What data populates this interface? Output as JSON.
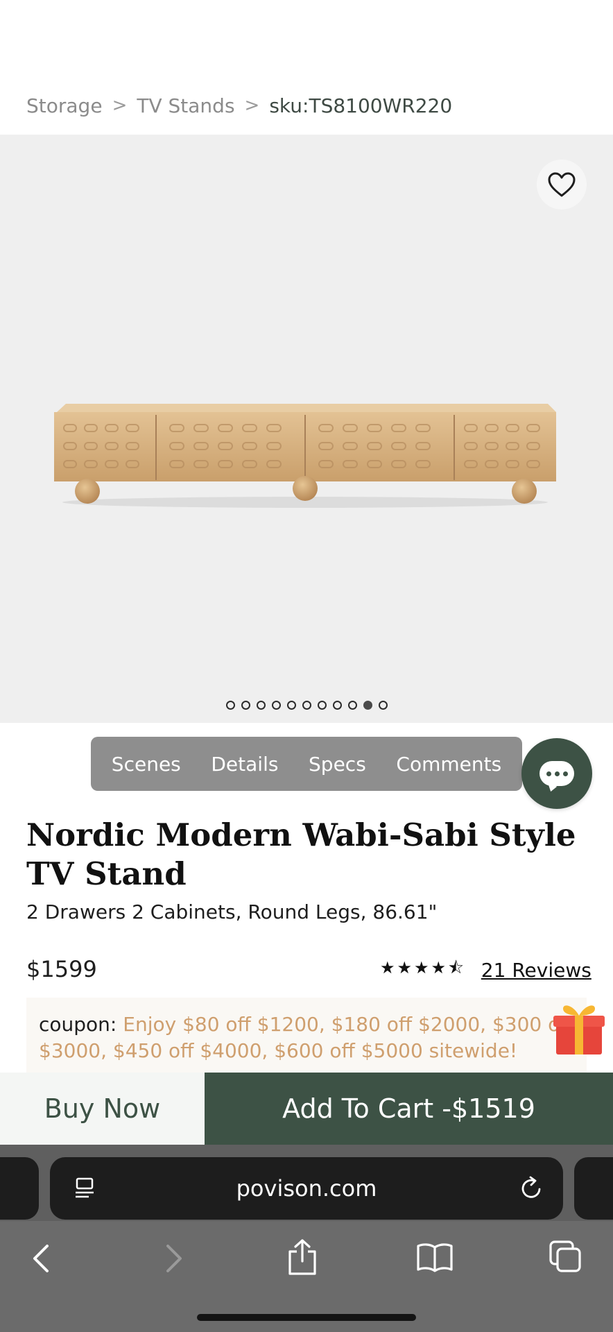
{
  "breadcrumb": {
    "items": [
      "Storage",
      "TV Stands"
    ],
    "separator": ">",
    "current": "sku:TS8100WR220"
  },
  "gallery": {
    "total_images": 11,
    "active_index": 9,
    "image_icon": "tv-stand-product-image",
    "wishlist_icon": "heart-icon"
  },
  "tabs": [
    "Scenes",
    "Details",
    "Specs",
    "Comments"
  ],
  "chat": {
    "icon": "chat-bubble-icon"
  },
  "product": {
    "title": "Nordic Modern Wabi-Sabi Style TV Stand",
    "subtitle": "2 Drawers 2 Cabinets, Round Legs, 86.61\"",
    "price": "$1599",
    "rating_stars": "★★★★⯪",
    "rating_value": 4.5,
    "reviews": "21 Reviews"
  },
  "coupon": {
    "label": "coupon:",
    "text": "Enjoy $80 off $1200, $180 off $2000, $300 off $3000, $450 off $4000, $600 off $5000 sitewide!",
    "icon": "gift-box-icon"
  },
  "actions": {
    "buy_now": "Buy Now",
    "add_to_cart": "Add To Cart -$1519"
  },
  "browser": {
    "url": "povison.com",
    "icons": [
      "reader-icon",
      "reload-icon",
      "back-icon",
      "forward-icon",
      "share-icon",
      "bookmarks-icon",
      "tabs-icon"
    ]
  },
  "colors": {
    "brand_green": "#3d5245",
    "coupon_text": "#cf9f6e",
    "tab_bar": "#8e8e8e",
    "hero_bg": "#efefef"
  }
}
